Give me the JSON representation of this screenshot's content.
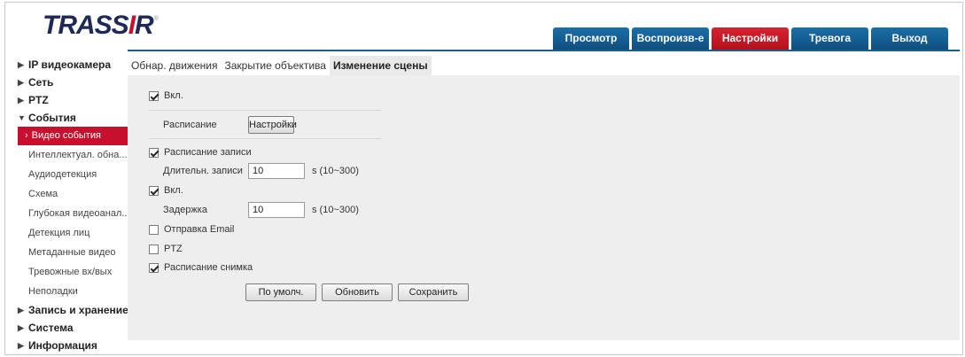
{
  "brand": {
    "logo_main": "TRASS",
    "logo_i": "I",
    "logo_r": "R",
    "logo_reg": "®"
  },
  "topnav": [
    {
      "label": "Просмотр",
      "active": false
    },
    {
      "label": "Воспроизв-е",
      "active": false
    },
    {
      "label": "Настройки",
      "active": true
    },
    {
      "label": "Тревога",
      "active": false
    },
    {
      "label": "Выход",
      "active": false
    }
  ],
  "sidebar": {
    "groups_top": [
      {
        "label": "IP видеокамера",
        "arrow": "▶"
      },
      {
        "label": "Сеть",
        "arrow": "▶"
      },
      {
        "label": "PTZ",
        "arrow": "▶"
      },
      {
        "label": "События",
        "arrow": "▼"
      }
    ],
    "event_items": [
      {
        "label": "Видео события",
        "active": true,
        "chevron": "›"
      },
      {
        "label": "Интеллектуал. обна..."
      },
      {
        "label": "Аудиодетекция"
      },
      {
        "label": "Схема"
      },
      {
        "label": "Глубокая видеоанал..."
      },
      {
        "label": "Детекция лиц"
      },
      {
        "label": "Метаданные видео"
      },
      {
        "label": "Тревожные вх/вых"
      },
      {
        "label": "Неполадки"
      }
    ],
    "groups_bottom": [
      {
        "label": "Запись и хранение",
        "arrow": "▶"
      },
      {
        "label": "Система",
        "arrow": "▶"
      },
      {
        "label": "Информация",
        "arrow": "▶"
      }
    ]
  },
  "subtabs": [
    {
      "label": "Обнар. движения",
      "active": false
    },
    {
      "label": "Закрытие объектива",
      "active": false
    },
    {
      "label": "Изменение сцены",
      "active": true
    }
  ],
  "form": {
    "enable": {
      "label": "Вкл.",
      "checked": true
    },
    "schedule": {
      "label": "Расписание",
      "button": "Настройки"
    },
    "record_schedule": {
      "label": "Расписание записи",
      "checked": true
    },
    "record_duration": {
      "label": "Длительн. записи",
      "value": "10",
      "unit": "s (10~300)"
    },
    "enable2": {
      "label": "Вкл.",
      "checked": true
    },
    "delay": {
      "label": "Задержка",
      "value": "10",
      "unit": "s (10~300)"
    },
    "send_email": {
      "label": "Отправка Email",
      "checked": false
    },
    "ptz": {
      "label": "PTZ",
      "checked": false
    },
    "snapshot_schedule": {
      "label": "Расписание снимка",
      "checked": true
    }
  },
  "buttons": {
    "default": "По умолч.",
    "refresh": "Обновить",
    "save": "Сохранить"
  },
  "colors": {
    "nav_blue": "#0f4f80",
    "nav_active_red": "#c8102e",
    "logo_navy": "#1e2a55"
  }
}
